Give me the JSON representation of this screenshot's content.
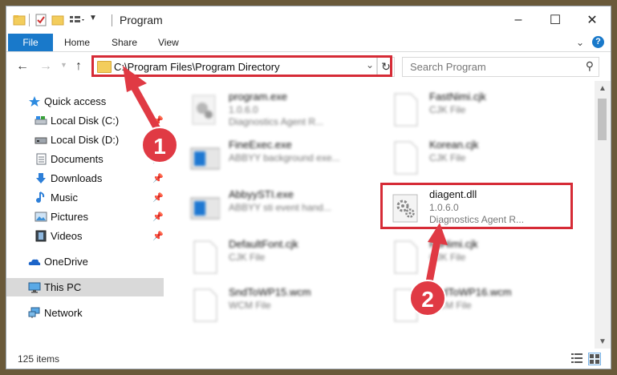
{
  "window": {
    "title": "Program"
  },
  "ribbon": {
    "tabs": [
      "File",
      "Home",
      "Share",
      "View"
    ],
    "help": "?"
  },
  "address": {
    "path": "C:\\Program Files\\Program Directory"
  },
  "search": {
    "placeholder": "Search Program"
  },
  "nav": {
    "items": [
      {
        "label": "Quick access",
        "icon": "star-icon"
      },
      {
        "label": "Local Disk (C:)",
        "icon": "drive-icon",
        "pinned": true
      },
      {
        "label": "Local Disk (D:)",
        "icon": "drive-icon"
      },
      {
        "label": "Documents",
        "icon": "documents-icon",
        "pinned": true
      },
      {
        "label": "Downloads",
        "icon": "download-arrow-icon",
        "pinned": true
      },
      {
        "label": "Music",
        "icon": "music-note-icon",
        "pinned": true
      },
      {
        "label": "Pictures",
        "icon": "pictures-icon",
        "pinned": true
      },
      {
        "label": "Videos",
        "icon": "film-icon",
        "pinned": true
      },
      {
        "label": "OneDrive",
        "icon": "cloud-icon"
      },
      {
        "label": "This PC",
        "icon": "monitor-icon"
      },
      {
        "label": "Network",
        "icon": "network-icon"
      }
    ]
  },
  "files": [
    {
      "name": "program.exe",
      "line2": "1.0.6.0",
      "line3": "Diagnostics Agent R..."
    },
    {
      "name": "FastNimi.cjk",
      "line2": "CJK File",
      "line3": ""
    },
    {
      "name": "FineExec.exe",
      "line2": "ABBYY background exe...",
      "line3": ""
    },
    {
      "name": "Korean.cjk",
      "line2": "CJK File",
      "line3": ""
    },
    {
      "name": "AbbyySTI.exe",
      "line2": "ABBYY sti event hand...",
      "line3": ""
    },
    {
      "name": "diagent.dll",
      "line2": "1.0.6.0",
      "line3": "Diagnostics Agent R..."
    },
    {
      "name": "DefaultFont.cjk",
      "line2": "CJK File",
      "line3": ""
    },
    {
      "name": "FuHimi.cjk",
      "line2": "CJK File",
      "line3": ""
    },
    {
      "name": "SndToWP15.wcm",
      "line2": "WCM File",
      "line3": ""
    },
    {
      "name": "SndToWP16.wcm",
      "line2": "WCM File",
      "line3": ""
    }
  ],
  "status": {
    "count": "125 items"
  },
  "annotations": {
    "badge1": "1",
    "badge2": "2"
  },
  "colors": {
    "accent": "#1979ca",
    "highlight": "#d62b36",
    "selection": "#cce8ff"
  }
}
